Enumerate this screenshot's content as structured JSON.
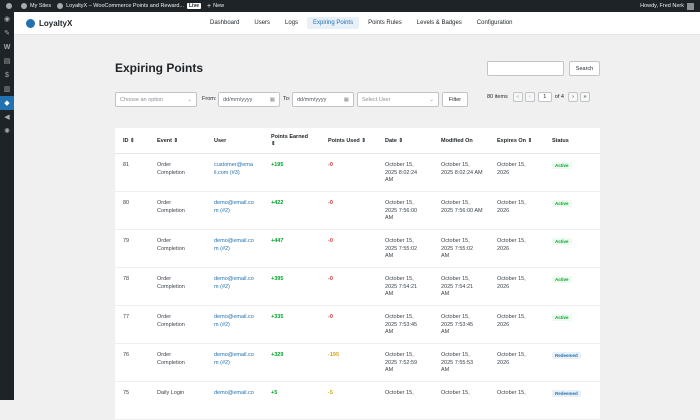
{
  "adminbar": {
    "my_sites": "My Sites",
    "site_name": "LoyaltyX – WooCommerce Points and Reward...",
    "live_badge": "Live",
    "new_label": "New",
    "howdy": "Howdy, Fred Nerk"
  },
  "brand": {
    "name": "LoyaltyX"
  },
  "nav": {
    "tabs": [
      {
        "label": "Dashboard"
      },
      {
        "label": "Users"
      },
      {
        "label": "Logs"
      },
      {
        "label": "Expiring Points"
      },
      {
        "label": "Points Rules"
      },
      {
        "label": "Levels & Badges"
      },
      {
        "label": "Configuration"
      }
    ]
  },
  "page": {
    "title": "Expiring Points"
  },
  "search": {
    "button_label": "Search"
  },
  "filters": {
    "event_placeholder": "Choose an option",
    "from_label": "From:",
    "from_placeholder": "dd/mm/yyyy",
    "to_label": "To:",
    "to_placeholder": "dd/mm/yyyy",
    "user_placeholder": "Select User",
    "filter_button": "Filter"
  },
  "pagination": {
    "items": "80 items",
    "first": "«",
    "prev": "‹",
    "current_page": "1",
    "of_label": "of 4",
    "next": "›",
    "last": "»"
  },
  "table": {
    "headers": {
      "id": "ID",
      "event": "Event",
      "user": "User",
      "points_earned": "Points Earned",
      "points_used": "Points Used",
      "date": "Date",
      "modified_on": "Modified On",
      "expires_on": "Expires On",
      "status": "Status"
    },
    "rows": [
      {
        "id": "81",
        "event1": "Order",
        "event2": "Completion",
        "user1": "customer@ema",
        "user2": "il.com (#3)",
        "earned": "+195",
        "used": "-0",
        "date1": "October 15,",
        "date2": "2025 8:02:24",
        "date3": "AM",
        "mod1": "October 15,",
        "mod2": "2025 8:02:24 AM",
        "mod3": "",
        "exp1": "October 15,",
        "exp2": "2026",
        "status": "Active"
      },
      {
        "id": "80",
        "event1": "Order",
        "event2": "Completion",
        "user1": "demo@email.co",
        "user2": "m (#2)",
        "earned": "+422",
        "used": "-0",
        "date1": "October 15,",
        "date2": "2025 7:56:00",
        "date3": "AM",
        "mod1": "October 15,",
        "mod2": "2025 7:56:00 AM",
        "mod3": "",
        "exp1": "October 15,",
        "exp2": "2026",
        "status": "Active"
      },
      {
        "id": "79",
        "event1": "Order",
        "event2": "Completion",
        "user1": "demo@email.co",
        "user2": "m (#2)",
        "earned": "+447",
        "used": "-0",
        "date1": "October 15,",
        "date2": "2025 7:55:02",
        "date3": "AM",
        "mod1": "October 15,",
        "mod2": "2025 7:55:02",
        "mod3": "AM",
        "exp1": "October 15,",
        "exp2": "2026",
        "status": "Active"
      },
      {
        "id": "78",
        "event1": "Order",
        "event2": "Completion",
        "user1": "demo@email.co",
        "user2": "m (#2)",
        "earned": "+395",
        "used": "-0",
        "date1": "October 15,",
        "date2": "2025 7:54:21",
        "date3": "AM",
        "mod1": "October 15,",
        "mod2": "2025 7:54:21",
        "mod3": "AM",
        "exp1": "October 15,",
        "exp2": "2026",
        "status": "Active"
      },
      {
        "id": "77",
        "event1": "Order",
        "event2": "Completion",
        "user1": "demo@email.co",
        "user2": "m (#2)",
        "earned": "+335",
        "used": "-0",
        "date1": "October 15,",
        "date2": "2025 7:53:45",
        "date3": "AM",
        "mod1": "October 15,",
        "mod2": "2025 7:53:45",
        "mod3": "AM",
        "exp1": "October 15,",
        "exp2": "2026",
        "status": "Active"
      },
      {
        "id": "76",
        "event1": "Order",
        "event2": "Completion",
        "user1": "demo@email.co",
        "user2": "m (#2)",
        "earned": "+329",
        "used": "-195",
        "date1": "October 15,",
        "date2": "2025 7:52:59",
        "date3": "AM",
        "mod1": "October 15,",
        "mod2": "2025 7:55:53",
        "mod3": "AM",
        "exp1": "October 15,",
        "exp2": "2026",
        "status": "Redeemed"
      },
      {
        "id": "75",
        "event1": "Daily Login",
        "event2": "",
        "user1": "demo@email.co",
        "user2": "",
        "earned": "+5",
        "used": "-5",
        "date1": "October 15,",
        "date2": "",
        "date3": "",
        "mod1": "October 15,",
        "mod2": "",
        "mod3": "",
        "exp1": "October 15,",
        "exp2": "",
        "status": "Redeemed"
      }
    ]
  }
}
